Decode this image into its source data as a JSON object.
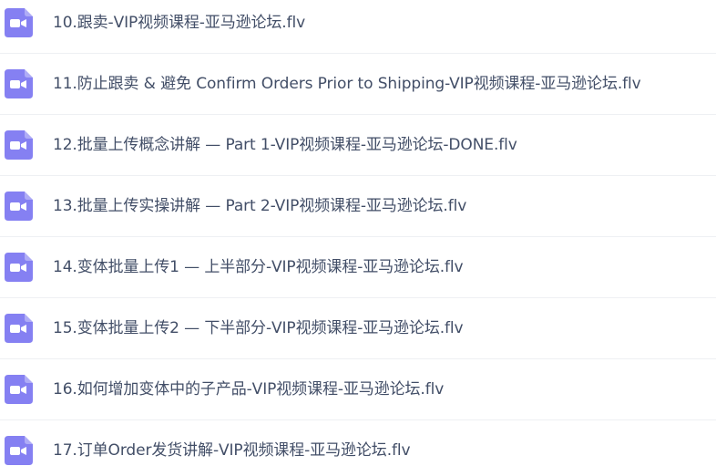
{
  "icon_color": "#8580f2",
  "files": [
    {
      "name": "10.跟卖-VIP视频课程-亚马逊论坛.flv",
      "icon": "video-file-icon"
    },
    {
      "name": "11.防止跟卖 & 避免 Confirm Orders Prior to Shipping-VIP视频课程-亚马逊论坛.flv",
      "icon": "video-file-icon"
    },
    {
      "name": "12.批量上传概念讲解 — Part 1-VIP视频课程-亚马逊论坛-DONE.flv",
      "icon": "video-file-icon"
    },
    {
      "name": "13.批量上传实操讲解 — Part 2-VIP视频课程-亚马逊论坛.flv",
      "icon": "video-file-icon"
    },
    {
      "name": "14.变体批量上传1 — 上半部分-VIP视频课程-亚马逊论坛.flv",
      "icon": "video-file-icon"
    },
    {
      "name": "15.变体批量上传2 — 下半部分-VIP视频课程-亚马逊论坛.flv",
      "icon": "video-file-icon"
    },
    {
      "name": "16.如何增加变体中的子产品-VIP视频课程-亚马逊论坛.flv",
      "icon": "video-file-icon"
    },
    {
      "name": "17.订单Order发货讲解-VIP视频课程-亚马逊论坛.flv",
      "icon": "video-file-icon"
    }
  ]
}
